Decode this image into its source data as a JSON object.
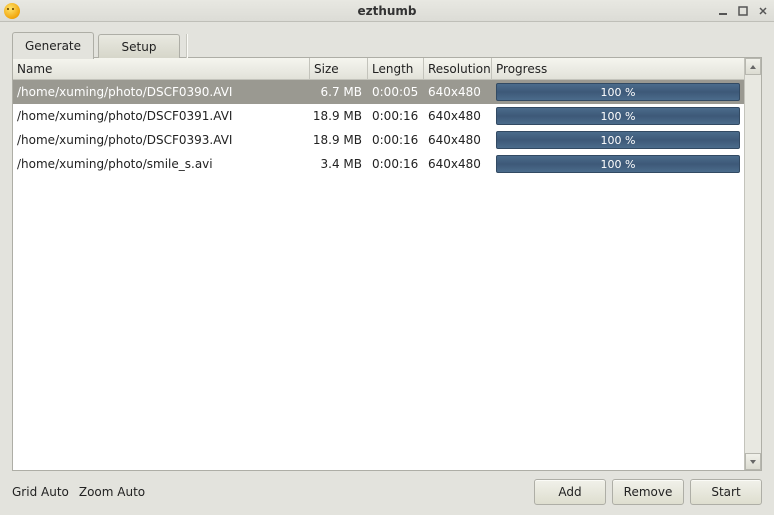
{
  "window": {
    "title": "ezthumb"
  },
  "tabs": {
    "generate": "Generate",
    "setup": "Setup"
  },
  "columns": {
    "name": "Name",
    "size": "Size",
    "length": "Length",
    "resolution": "Resolution",
    "progress": "Progress"
  },
  "rows": [
    {
      "name": "/home/xuming/photo/DSCF0390.AVI",
      "size": "6.7 MB",
      "length": "0:00:05",
      "resolution": "640x480",
      "progress": "100 %",
      "selected": true
    },
    {
      "name": "/home/xuming/photo/DSCF0391.AVI",
      "size": "18.9 MB",
      "length": "0:00:16",
      "resolution": "640x480",
      "progress": "100 %",
      "selected": false
    },
    {
      "name": "/home/xuming/photo/DSCF0393.AVI",
      "size": "18.9 MB",
      "length": "0:00:16",
      "resolution": "640x480",
      "progress": "100 %",
      "selected": false
    },
    {
      "name": "/home/xuming/photo/smile_s.avi",
      "size": "3.4 MB",
      "length": "0:00:16",
      "resolution": "640x480",
      "progress": "100 %",
      "selected": false
    }
  ],
  "status": {
    "grid": "Grid Auto",
    "zoom": "Zoom Auto"
  },
  "buttons": {
    "add": "Add",
    "remove": "Remove",
    "start": "Start"
  }
}
